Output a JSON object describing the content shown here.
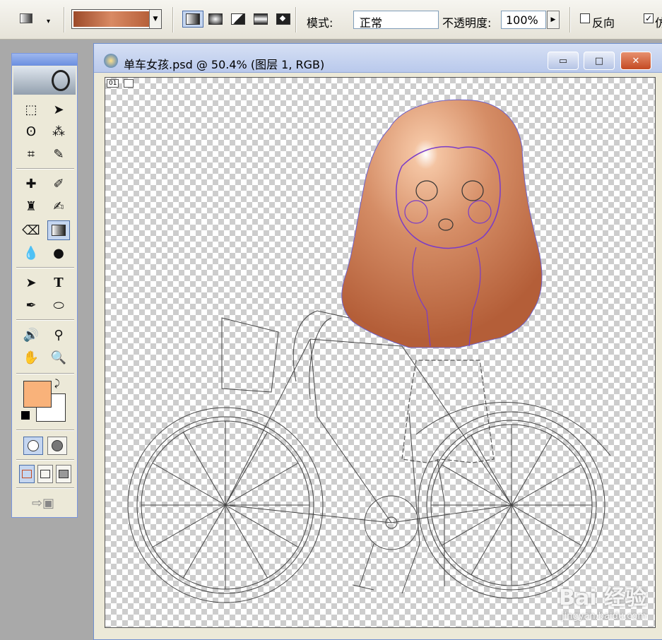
{
  "options_bar": {
    "mode_label": "模式:",
    "mode_value": "正常",
    "opacity_label": "不透明度:",
    "opacity_value": "100%",
    "reverse_label": "反向",
    "dither_label": "仿",
    "gradient_colors": [
      "#9c4a2a",
      "#d98a64",
      "#b7603a"
    ]
  },
  "tools": {
    "foreground_color": "#f9b27a",
    "background_color": "#ffffff",
    "items": [
      "marquee-icon",
      "move-icon",
      "lasso-icon",
      "magic-wand-icon",
      "crop-icon",
      "slice-icon",
      "healing-brush-icon",
      "brush-icon",
      "clone-stamp-icon",
      "history-brush-icon",
      "eraser-icon",
      "gradient-icon",
      "blur-icon",
      "dodge-icon",
      "path-select-icon",
      "type-icon",
      "pen-icon",
      "ellipse-icon",
      "notes-icon",
      "eyedropper-icon",
      "hand-icon",
      "zoom-icon"
    ],
    "type_glyph": "T"
  },
  "document": {
    "title": "单车女孩.psd @ 50.4% (图层 1, RGB)",
    "layer_tag": "01",
    "watermark_main": "Bai 经验",
    "watermark_sub": "jingyan.baidu.com",
    "hair_color": "#c8754c"
  }
}
